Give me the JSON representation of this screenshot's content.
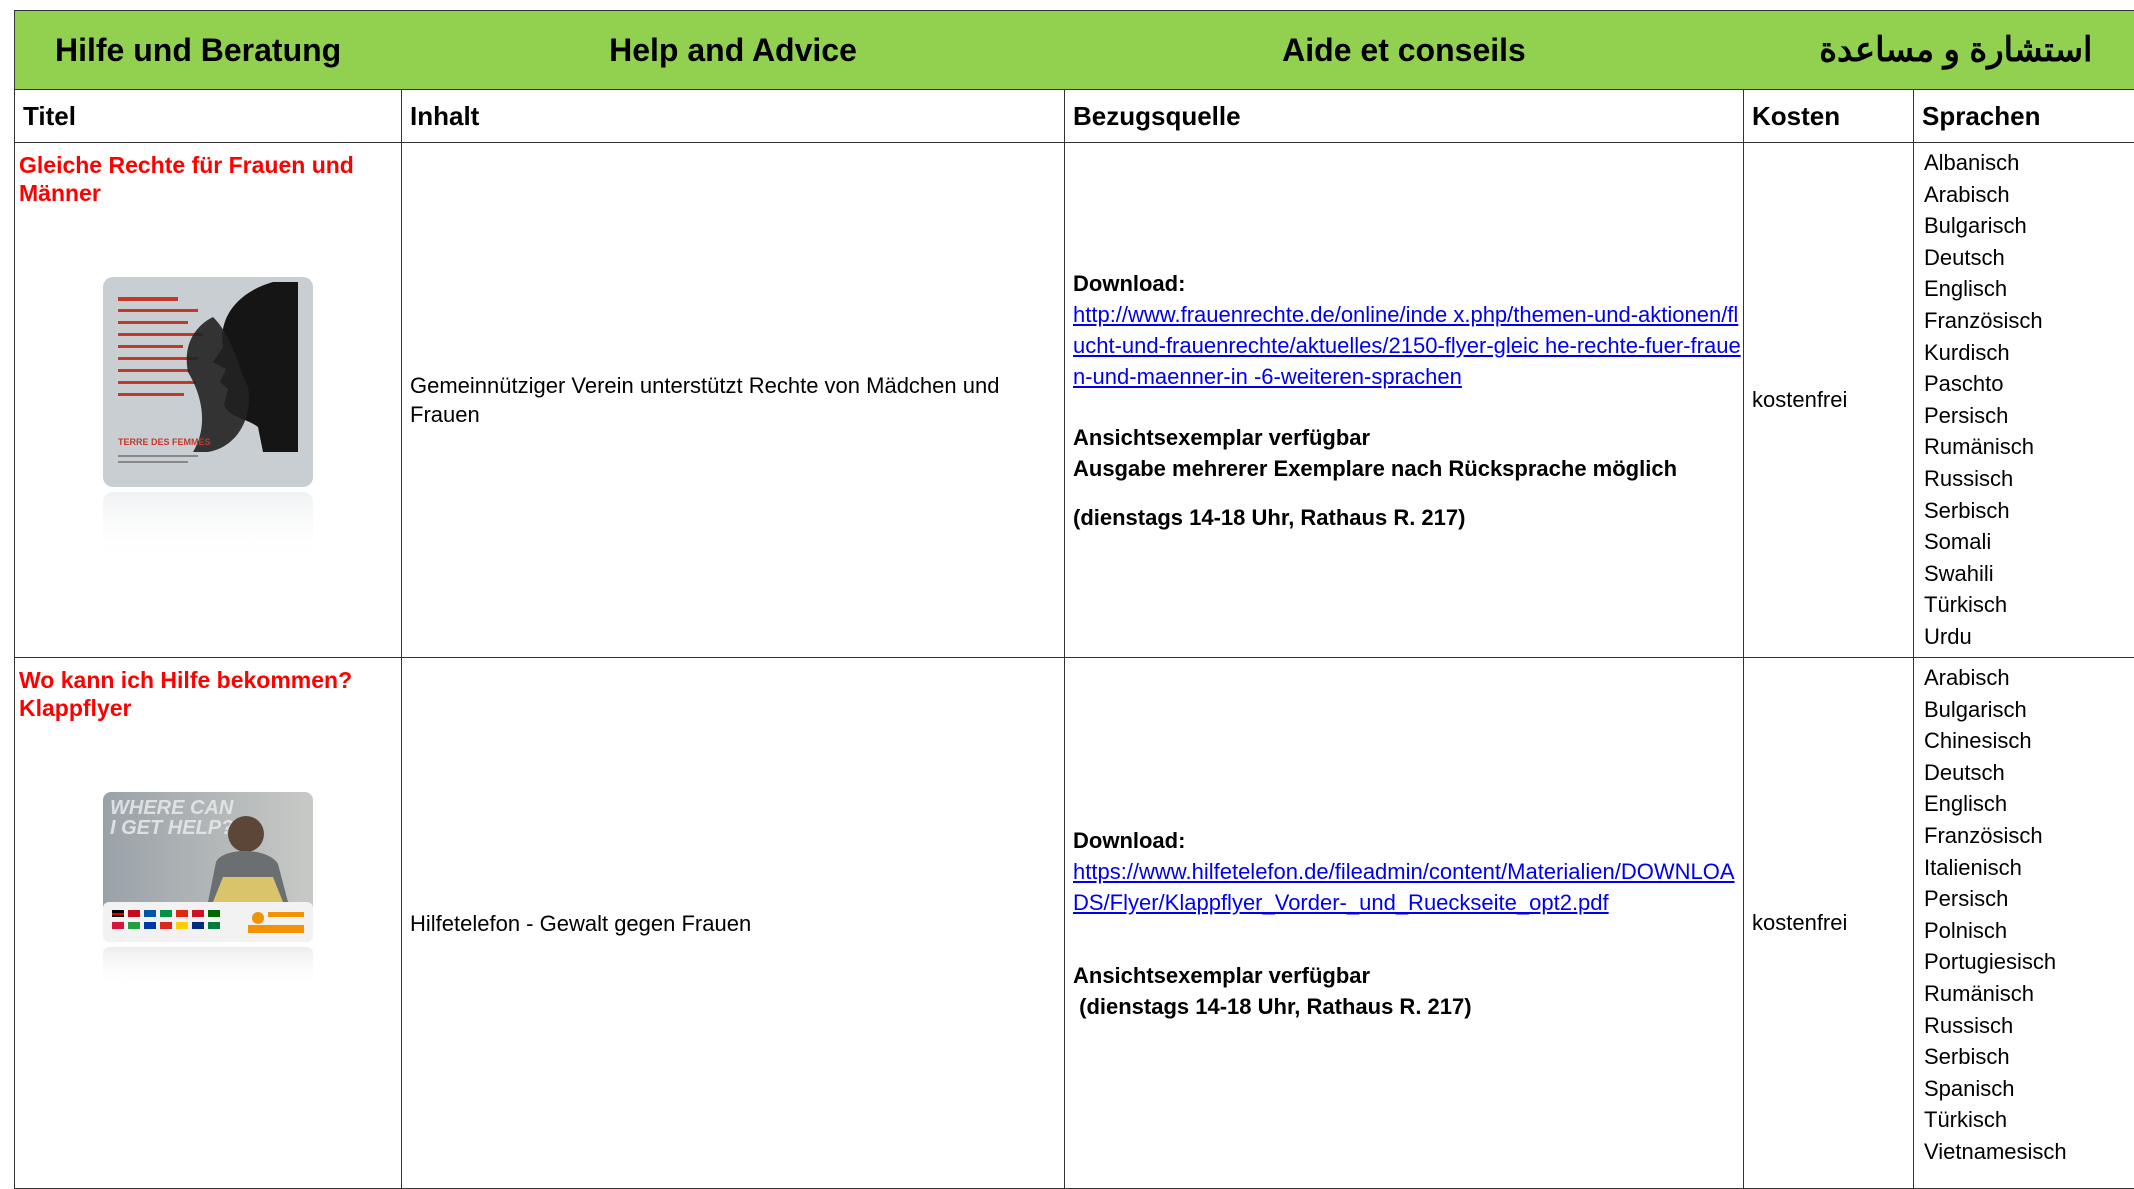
{
  "banner": {
    "de": "Hilfe und Beratung",
    "en": "Help and Advice",
    "fr": "Aide et conseils",
    "ar": "استشارة و مساعدة"
  },
  "headers": {
    "titel": "Titel",
    "inhalt": "Inhalt",
    "bezugsquelle": "Bezugsquelle",
    "kosten": "Kosten",
    "sprachen": "Sprachen"
  },
  "rows": [
    {
      "title": "Gleiche Rechte für Frauen und Männer",
      "thumb_label": "TERRE DES FEMMES",
      "inhalt": "Gemeinnütziger Verein unterstützt Rechte von Mädchen und Frauen",
      "download_label": "Download:",
      "link": "http://www.frauenrechte.de/online/inde x.php/themen-und-aktionen/flucht-und-frauenrechte/aktuelles/2150-flyer-gleic he-rechte-fuer-frauen-und-maenner-in                    -6-weiteren-sprachen",
      "note1": "Ansichtsexemplar verfügbar",
      "note2": "Ausgabe mehrerer Exemplare nach Rücksprache möglich",
      "note3": "(dienstags 14-18 Uhr, Rathaus R. 217)",
      "kosten": "kostenfrei",
      "sprachen": [
        "Albanisch",
        "Arabisch",
        "Bulgarisch",
        "Deutsch",
        "Englisch",
        "Französisch",
        "Kurdisch",
        "Paschto",
        "Persisch",
        "Rumänisch",
        "Russisch",
        "Serbisch",
        "Somali",
        "Swahili",
        "Türkisch",
        "Urdu"
      ]
    },
    {
      "title": "Wo kann ich Hilfe bekommen? Klappflyer",
      "thumb_label": "WHERE CAN I GET HELP?",
      "inhalt": "Hilfetelefon - Gewalt gegen Frauen",
      "download_label": "Download:",
      "link": "https://www.hilfetelefon.de/fileadmin/content/Materialien/DOWNLOADS/Flyer/Klappflyer_Vorder-_und_Rueckseite_opt2.pdf",
      "note1": "Ansichtsexemplar verfügbar",
      "note2": " (dienstags 14-18 Uhr, Rathaus R. 217)",
      "kosten": "kostenfrei",
      "sprachen": [
        "Arabisch",
        "Bulgarisch",
        "Chinesisch",
        "Deutsch",
        "Englisch",
        "Französisch",
        "Italienisch",
        "Persisch",
        "Polnisch",
        "Portugiesisch",
        "Rumänisch",
        "Russisch",
        "Serbisch",
        "Spanisch",
        "Türkisch",
        "Vietnamesisch"
      ]
    }
  ]
}
